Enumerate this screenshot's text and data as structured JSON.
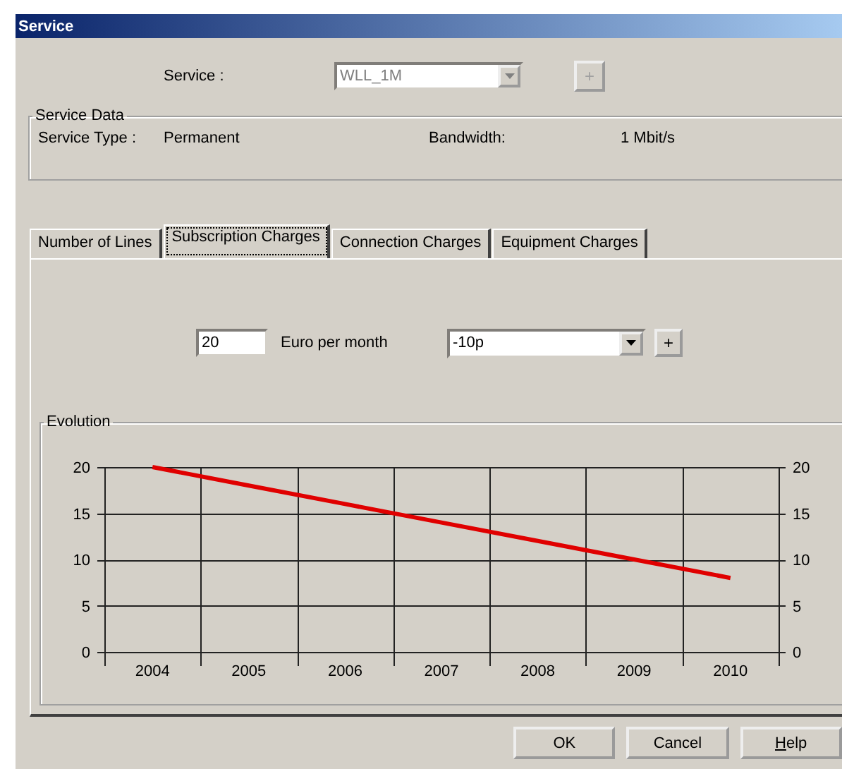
{
  "window": {
    "title": "Service"
  },
  "service": {
    "label": "Service :",
    "value": "WLL_1M",
    "disabled": true,
    "add_button": {
      "label": "+",
      "disabled": true
    }
  },
  "service_data": {
    "title": "Service Data",
    "fields": [
      {
        "label": "Service Type :",
        "value": "Permanent"
      },
      {
        "label": "Bandwidth:",
        "value": "1 Mbit/s"
      }
    ]
  },
  "tabs": [
    {
      "label": "Number of Lines",
      "selected": false
    },
    {
      "label": "Subscription Charges",
      "selected": true
    },
    {
      "label": "Connection Charges",
      "selected": false
    },
    {
      "label": "Equipment Charges",
      "selected": false
    }
  ],
  "subscription": {
    "amount": "20",
    "unit": "Euro per month",
    "rate": "-10p",
    "add_button": {
      "label": "+",
      "disabled": false
    }
  },
  "evolution": {
    "title": "Evolution",
    "chart_data": {
      "type": "line",
      "categories": [
        "2004",
        "2005",
        "2006",
        "2007",
        "2008",
        "2009",
        "2010"
      ],
      "series": [
        {
          "color": "#e00000",
          "values": [
            20,
            18,
            16,
            14,
            12,
            10,
            8
          ]
        }
      ],
      "ylim": [
        0,
        20
      ],
      "yticks": [
        0,
        5,
        10,
        15,
        20
      ],
      "y2ticks": [
        0,
        5,
        10,
        15,
        20
      ],
      "y2lim": [
        0,
        20
      ],
      "grid": true
    }
  },
  "buttons": [
    {
      "label": "OK",
      "kind": "plain"
    },
    {
      "label": "Cancel",
      "kind": "plain"
    },
    {
      "label": "Help",
      "kind": "mnemonic"
    }
  ]
}
